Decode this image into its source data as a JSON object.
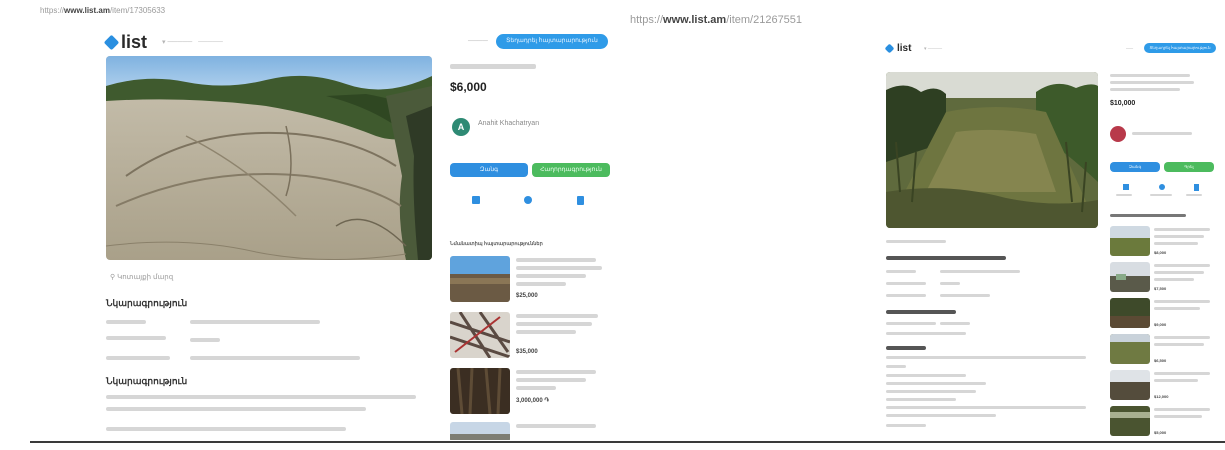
{
  "left": {
    "url_prefix": "https://",
    "url_domain": "www.list.am",
    "url_path": "/item/17305633",
    "logo_text": "list",
    "header_pill": "Տեղադրել հայտարարություն",
    "price": "$6,000",
    "seller_initial": "A",
    "seller_name": "Anahit Khachatryan",
    "call_button": "Զանգ",
    "message_button": "Հաղորդագրություն",
    "related_title": "Նմանատիպ հայտարարություններ",
    "related": [
      {
        "price": "$25,000"
      },
      {
        "price": "$35,000"
      },
      {
        "price": "3,000,000 ֏"
      },
      {
        "price": ""
      }
    ],
    "location": "Կոտայքի մարզ",
    "details_heading": "Նկարագրություն",
    "description_heading": "Նկարագրություն"
  },
  "right": {
    "url_prefix": "https://",
    "url_domain": "www.list.am",
    "url_path": "/item/21267551",
    "logo_text": "list",
    "header_pill": "Տեղադրել հայտարարություն",
    "price": "$10,000",
    "call_button": "Զանգ",
    "message_button": "Գրել",
    "related_items": [
      {
        "price": "$8,000"
      },
      {
        "price": "$7,500"
      },
      {
        "price": "$9,000"
      },
      {
        "price": "$6,500"
      },
      {
        "price": "$12,000"
      },
      {
        "price": "$5,000"
      }
    ]
  },
  "colors": {
    "accent_blue": "#2f8fe0",
    "accent_green": "#4cbb5e",
    "seller_left": "#2e8a74",
    "seller_right": "#b8394a"
  }
}
